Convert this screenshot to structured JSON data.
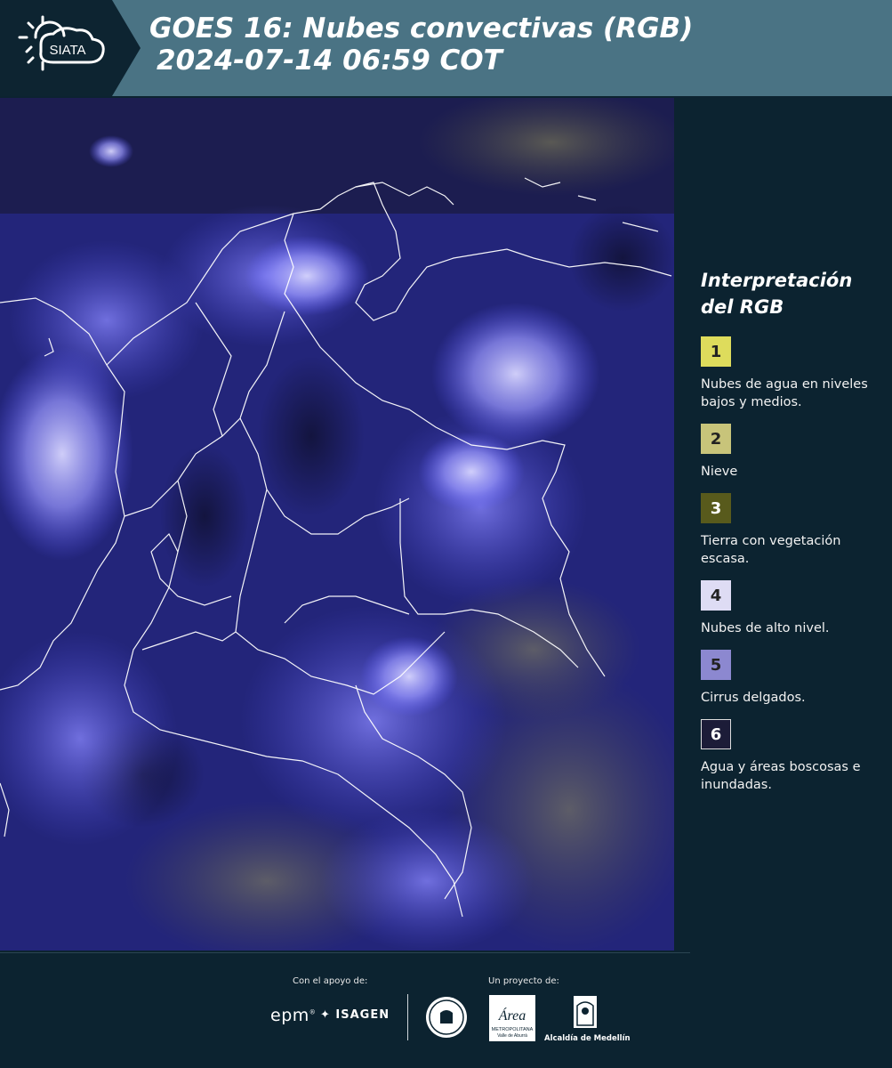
{
  "header": {
    "logo_text": "SIATA",
    "title_line1": "GOES 16: Nubes convectivas (RGB)",
    "title_line2": "2024-07-14 06:59 COT"
  },
  "legend": {
    "title_line1": "Interpretación",
    "title_line2": "del RGB",
    "items": [
      {
        "number": "1",
        "color": "#dedc5c",
        "label": "Nubes de agua en niveles bajos y medios."
      },
      {
        "number": "2",
        "color": "#c8c47a",
        "label": "Nieve"
      },
      {
        "number": "3",
        "color": "#585a1c",
        "label": "Tierra con vegetación escasa."
      },
      {
        "number": "4",
        "color": "#dedcf4",
        "label": "Nubes de alto nivel."
      },
      {
        "number": "5",
        "color": "#8c88d0",
        "label": "Cirrus delgados."
      },
      {
        "number": "6",
        "color": "#1c1c38",
        "label": "Agua y áreas boscosas e inundadas."
      }
    ]
  },
  "footer": {
    "support_label": "Con el apoyo de:",
    "project_label": "Un proyecto de:",
    "epm": "epm",
    "isagen": "ISAGEN",
    "area_text": "Área",
    "area_sub1": "METROPOLITANA",
    "area_sub2": "Valle de Aburrá",
    "alcaldia": "Alcaldía de Medellín"
  }
}
